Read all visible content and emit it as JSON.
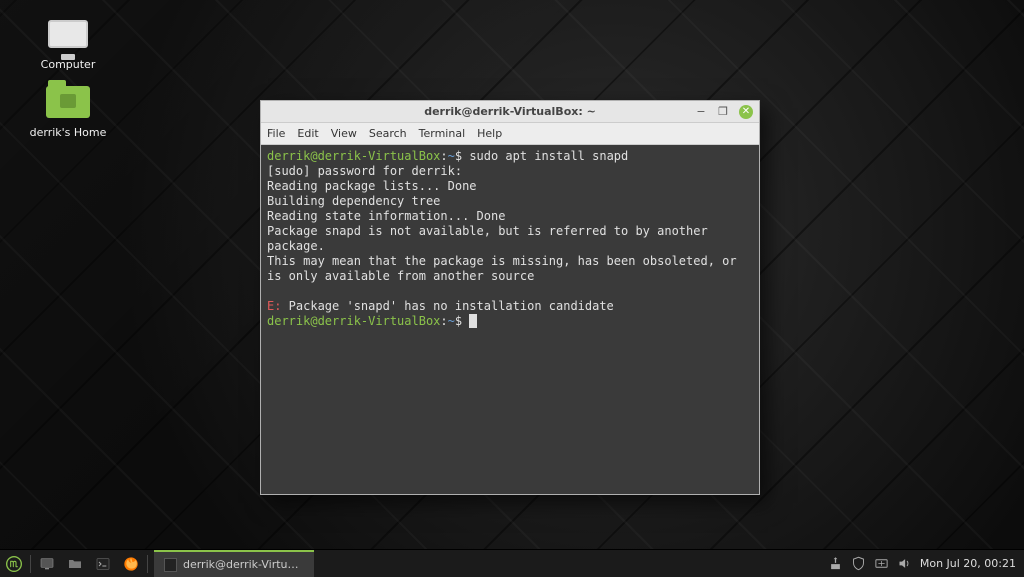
{
  "desktop": {
    "icons": [
      {
        "name": "computer",
        "label": "Computer"
      },
      {
        "name": "home-folder",
        "label": "derrik's Home"
      }
    ]
  },
  "terminal": {
    "title": "derrik@derrik-VirtualBox: ~",
    "menu": [
      "File",
      "Edit",
      "View",
      "Search",
      "Terminal",
      "Help"
    ],
    "prompt_user_host": "derrik@derrik-VirtualBox",
    "prompt_path": "~",
    "lines": {
      "l1_cmd": "sudo apt install snapd",
      "l2": "[sudo] password for derrik:",
      "l3": "Reading package lists... Done",
      "l4": "Building dependency tree",
      "l5": "Reading state information... Done",
      "l6": "Package snapd is not available, but is referred to by another package.",
      "l7": "This may mean that the package is missing, has been obsoleted, or",
      "l8": "is only available from another source",
      "err_prefix": "E:",
      "err_msg": " Package 'snapd' has no installation candidate"
    },
    "window_controls": {
      "minimize": "−",
      "maximize": "❐",
      "close": "✕"
    }
  },
  "taskbar": {
    "active_task": "derrik@derrik-VirtualB...",
    "clock": "Mon Jul 20, 00:21",
    "colors": {
      "accent": "#8bc34a"
    }
  }
}
